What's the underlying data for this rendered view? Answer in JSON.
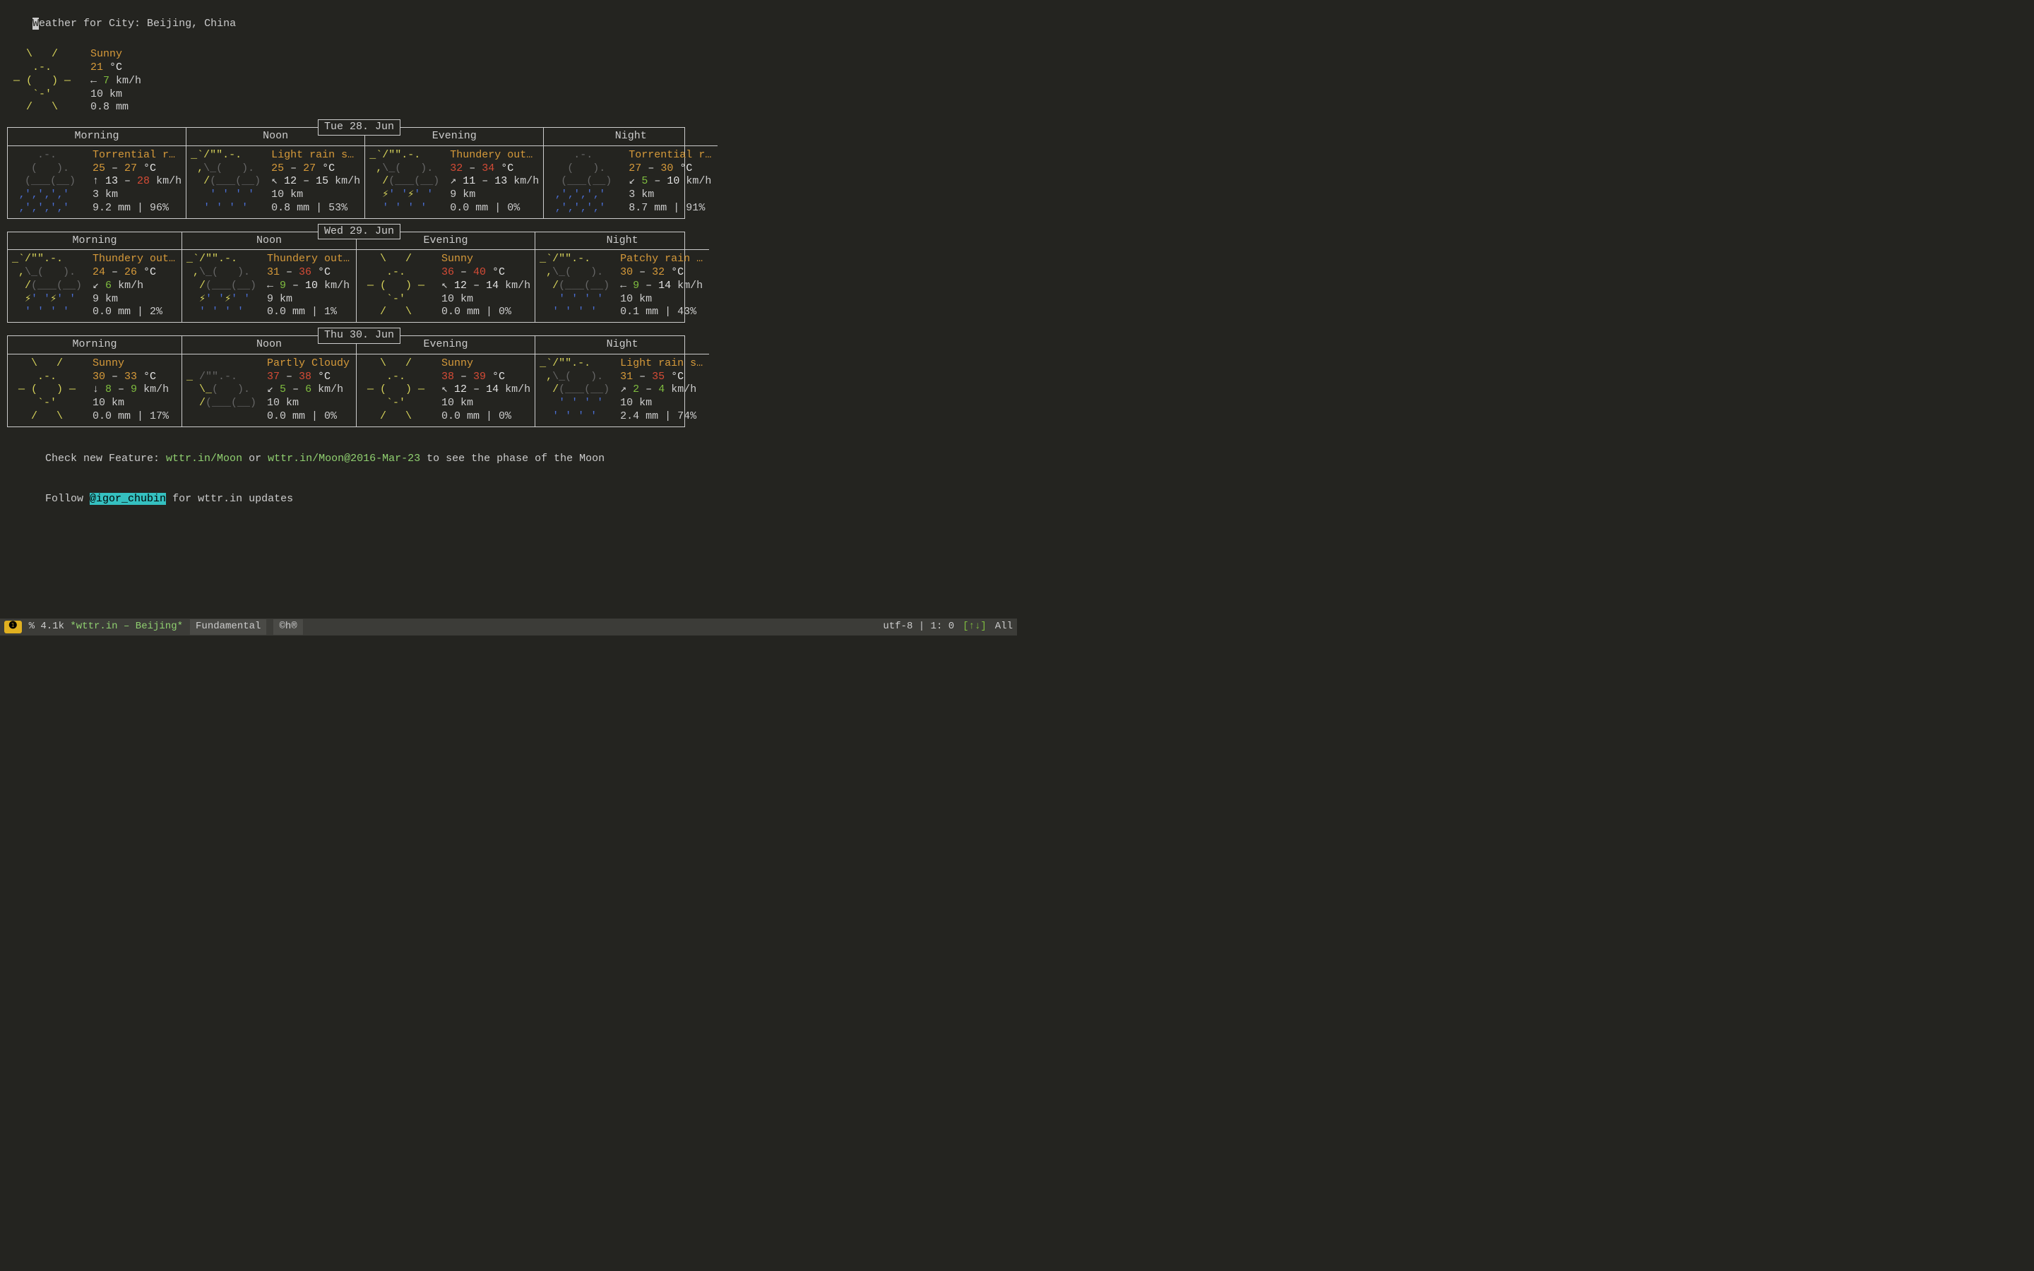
{
  "header": {
    "first_char": "W",
    "title_rest": "eather for City: Beijing, China"
  },
  "current": {
    "condition": "Sunny",
    "temp": "21",
    "temp_unit": " °C",
    "wind_arrow": "←",
    "wind": " 7",
    "wind_unit": " km/h",
    "vis": "10 km",
    "precip": "0.8 mm"
  },
  "art": {
    "sun": [
      "   \\   /    ",
      "    .-.     ",
      " ― (   ) ―  ",
      "    `-'     ",
      "   /   \\    "
    ],
    "rain_heavy": [
      "    .-.     ",
      "   (   ).   ",
      "  (___(__)  ",
      " ‚'‚'‚'‚'   ",
      " ‚'‚'‚'‚'   "
    ],
    "rain_light": [
      "_`/\"\".-.    ",
      " ,\\_(   ).  ",
      "  /(___(__) ",
      "   ' ' ' '  ",
      "  ' ' ' '   "
    ],
    "thunder": [
      "_`/\"\".-.    ",
      " ,\\_(   ).  ",
      "  /(___(__) ",
      "  ⚡' '⚡' '  ",
      "  ' ' ' '   "
    ],
    "partly": [
      "            ",
      "_ /\"\".-.    ",
      "  \\_(   ).  ",
      "  /(___(__) ",
      "            "
    ]
  },
  "days": [
    {
      "label": "Tue 28. Jun",
      "periods": [
        {
          "name": "Morning",
          "art": "rain_heavy",
          "condition": "Torrential rai…",
          "t1": "25",
          "t2": "27",
          "t1c": "orange",
          "t2c": "orange",
          "wa": "↑",
          "w1": "13",
          "w2": "28",
          "w1c": "white",
          "w2c": "red",
          "vis": "3 km",
          "precip": "9.2 mm | 96%"
        },
        {
          "name": "Noon",
          "art": "rain_light",
          "condition": "Light rain sho…",
          "t1": "25",
          "t2": "27",
          "t1c": "orange",
          "t2c": "orange",
          "wa": "↖",
          "w1": "12",
          "w2": "15",
          "w1c": "white",
          "w2c": "white",
          "vis": "10 km",
          "precip": "0.8 mm | 53%"
        },
        {
          "name": "Evening",
          "art": "thunder",
          "condition": "Thundery outbr…",
          "t1": "32",
          "t2": "34",
          "t1c": "red",
          "t2c": "red",
          "wa": "↗",
          "w1": "11",
          "w2": "13",
          "w1c": "white",
          "w2c": "white",
          "vis": "9 km",
          "precip": "0.0 mm | 0%"
        },
        {
          "name": "Night",
          "art": "rain_heavy",
          "condition": "Torrential rai…",
          "t1": "27",
          "t2": "30",
          "t1c": "orange",
          "t2c": "orange",
          "wa": "↙",
          "w1": "5",
          "w2": "10",
          "w1c": "green",
          "w2c": "white",
          "vis": "3 km",
          "precip": "8.7 mm | 91%"
        }
      ]
    },
    {
      "label": "Wed 29. Jun",
      "periods": [
        {
          "name": "Morning",
          "art": "thunder",
          "condition": "Thundery outbr…",
          "t1": "24",
          "t2": "26",
          "t1c": "orange",
          "t2c": "orange",
          "wa": "↙",
          "w1": "6",
          "w2": "",
          "w1c": "green",
          "w2c": "",
          "vis": "9 km",
          "precip": "0.0 mm | 2%"
        },
        {
          "name": "Noon",
          "art": "thunder",
          "condition": "Thundery outbr…",
          "t1": "31",
          "t2": "36",
          "t1c": "orange",
          "t2c": "red",
          "wa": "←",
          "w1": "9",
          "w2": "10",
          "w1c": "green",
          "w2c": "white",
          "vis": "9 km",
          "precip": "0.0 mm | 1%"
        },
        {
          "name": "Evening",
          "art": "sun",
          "condition": "Sunny",
          "t1": "36",
          "t2": "40",
          "t1c": "red",
          "t2c": "red",
          "wa": "↖",
          "w1": "12",
          "w2": "14",
          "w1c": "white",
          "w2c": "white",
          "vis": "10 km",
          "precip": "0.0 mm | 0%"
        },
        {
          "name": "Night",
          "art": "rain_light",
          "condition": "Patchy rain ne…",
          "t1": "30",
          "t2": "32",
          "t1c": "orange",
          "t2c": "orange",
          "wa": "←",
          "w1": "9",
          "w2": "14",
          "w1c": "green",
          "w2c": "white",
          "vis": "10 km",
          "precip": "0.1 mm | 43%"
        }
      ]
    },
    {
      "label": "Thu 30. Jun",
      "periods": [
        {
          "name": "Morning",
          "art": "sun",
          "condition": "Sunny",
          "t1": "30",
          "t2": "33",
          "t1c": "orange",
          "t2c": "orange",
          "wa": "↓",
          "w1": "8",
          "w2": "9",
          "w1c": "green",
          "w2c": "green",
          "vis": "10 km",
          "precip": "0.0 mm | 17%"
        },
        {
          "name": "Noon",
          "art": "partly",
          "condition": "Partly Cloudy",
          "t1": "37",
          "t2": "38",
          "t1c": "red",
          "t2c": "red",
          "wa": "↙",
          "w1": "5",
          "w2": "6",
          "w1c": "green",
          "w2c": "green",
          "vis": "10 km",
          "precip": "0.0 mm | 0%"
        },
        {
          "name": "Evening",
          "art": "sun",
          "condition": "Sunny",
          "t1": "38",
          "t2": "39",
          "t1c": "red",
          "t2c": "red",
          "wa": "↖",
          "w1": "12",
          "w2": "14",
          "w1c": "white",
          "w2c": "white",
          "vis": "10 km",
          "precip": "0.0 mm | 0%"
        },
        {
          "name": "Night",
          "art": "rain_light",
          "condition": "Light rain sho…",
          "t1": "31",
          "t2": "35",
          "t1c": "orange",
          "t2c": "red",
          "wa": "↗",
          "w1": "2",
          "w2": "4",
          "w1c": "green",
          "w2c": "green",
          "vis": "10 km",
          "precip": "2.4 mm | 74%"
        }
      ]
    }
  ],
  "footer": {
    "l1a": "Check new Feature: ",
    "l1b": "wttr.in/Moon",
    "l1c": " or ",
    "l1d": "wttr.in/Moon@2016-Mar-23",
    "l1e": " to see the phase of the Moon",
    "l2a": "Follow ",
    "l2b": "@igor_chubin",
    "l2c": " for wttr.in updates"
  },
  "status": {
    "warn": "❶",
    "prefix": "% 4.1k ",
    "buffer": "*wttr.in – Beijing*",
    "mode": "Fundamental",
    "extra": "©h®",
    "encoding": "utf-8 | 1: 0",
    "arrows": "[↑↓]",
    "pos": "All"
  }
}
